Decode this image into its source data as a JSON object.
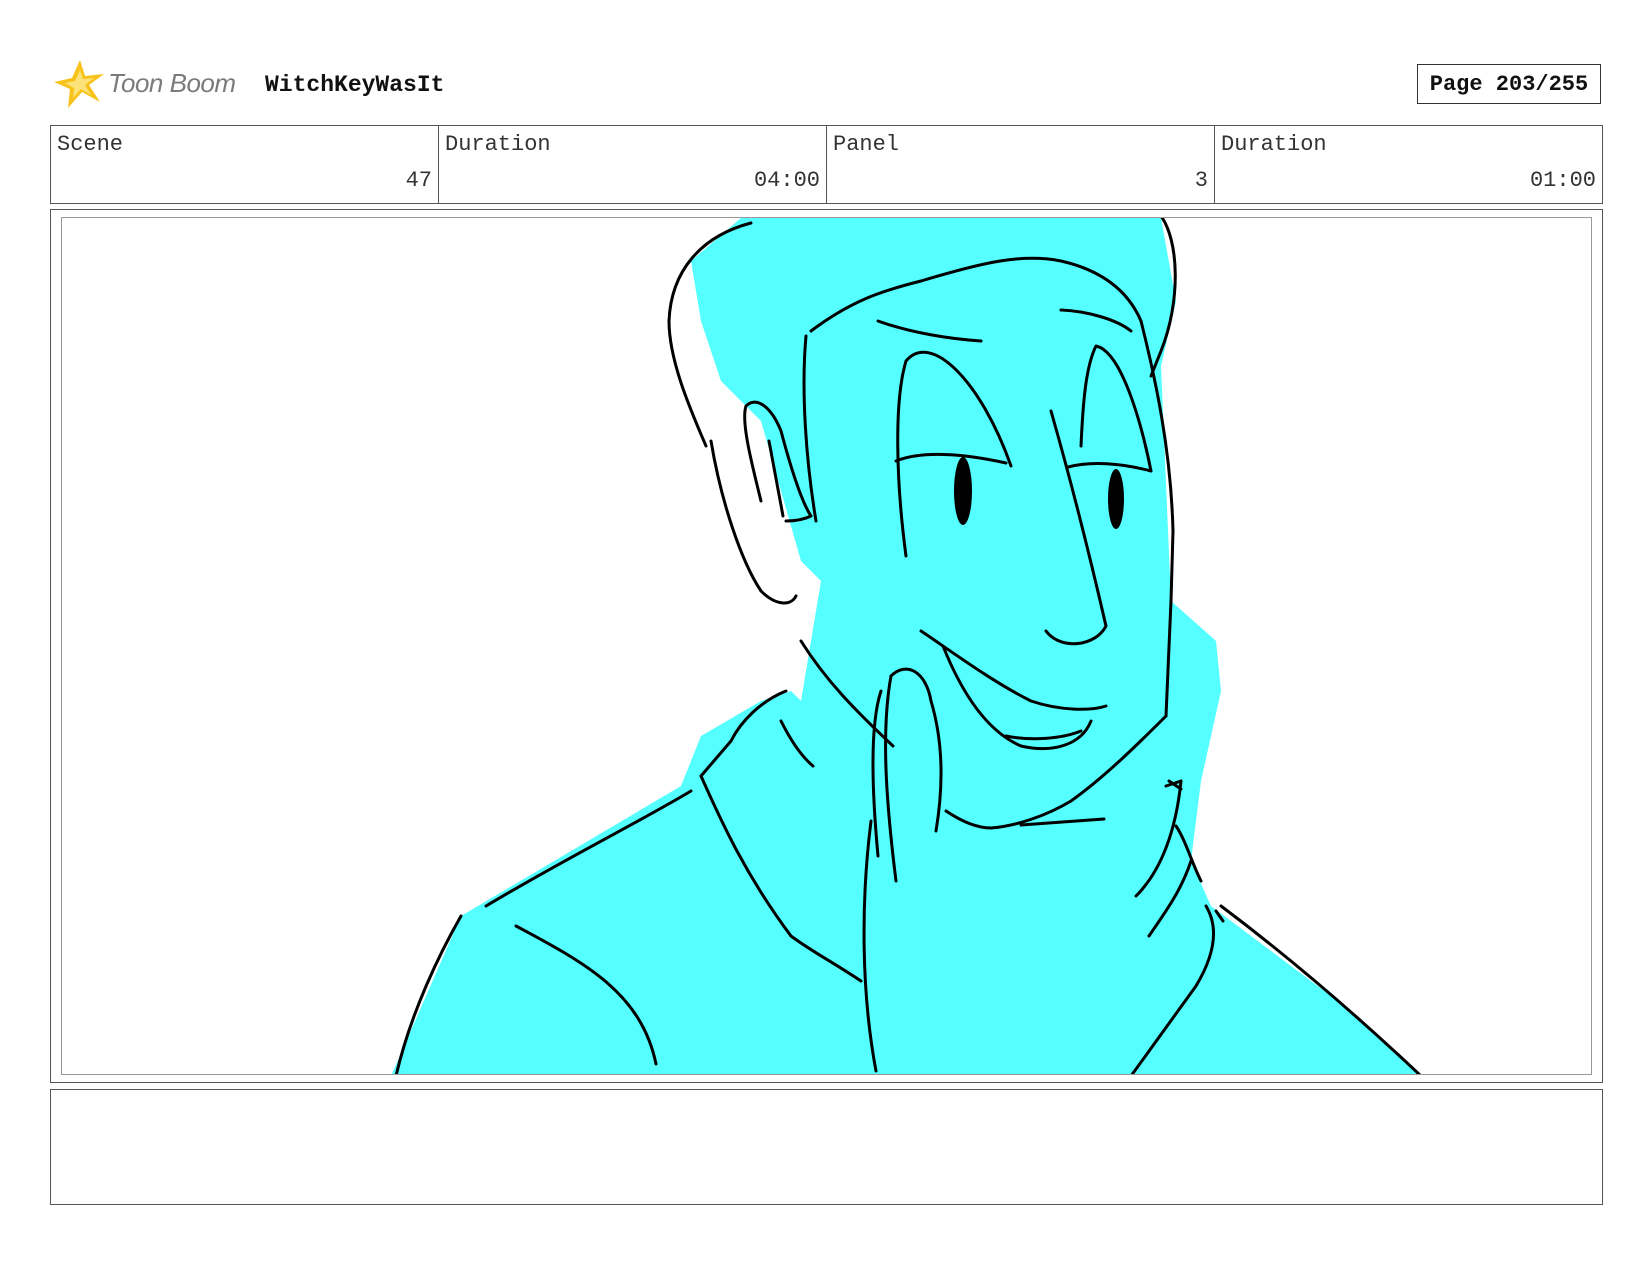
{
  "header": {
    "logo_text": "Toon Boom",
    "project_title": "WitchKeyWasIt",
    "page_label": "Page 203/255"
  },
  "info": {
    "scene_label": "Scene",
    "scene_value": "47",
    "scene_duration_label": "Duration",
    "scene_duration_value": "04:00",
    "panel_label": "Panel",
    "panel_value": "3",
    "panel_duration_label": "Duration",
    "panel_duration_value": "01:00"
  },
  "drawing": {
    "fill_color": "#55ffff",
    "line_color": "#000000",
    "subject": "character-smiling-hand-on-chin"
  },
  "colors": {
    "logo_star": "#f7c21a",
    "logo_text": "#7b7b7b"
  }
}
